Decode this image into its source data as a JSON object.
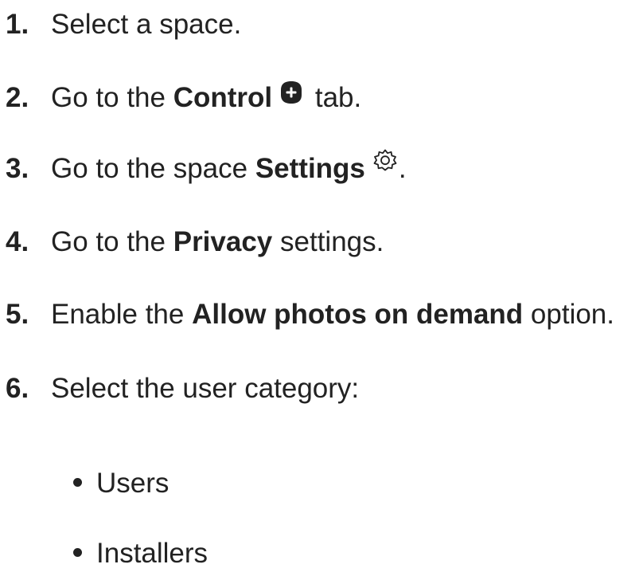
{
  "steps": [
    {
      "num": "1.",
      "text": "Select a space."
    },
    {
      "num": "2.",
      "pre": "Go to the ",
      "bold": "Control",
      "post": " tab.",
      "icon": "control-plus-icon"
    },
    {
      "num": "3.",
      "pre": "Go to the space ",
      "bold": "Settings",
      "post": ".",
      "icon": "gear-icon"
    },
    {
      "num": "4.",
      "pre": "Go to the ",
      "bold": "Privacy",
      "post": " settings."
    },
    {
      "num": "5.",
      "pre": "Enable the ",
      "bold": "Allow photos on demand",
      "post": " option."
    },
    {
      "num": "6.",
      "text": "Select the user category:"
    }
  ],
  "categories": [
    "Users",
    "Installers"
  ],
  "colors": {
    "text": "#222222",
    "background": "#ffffff"
  }
}
